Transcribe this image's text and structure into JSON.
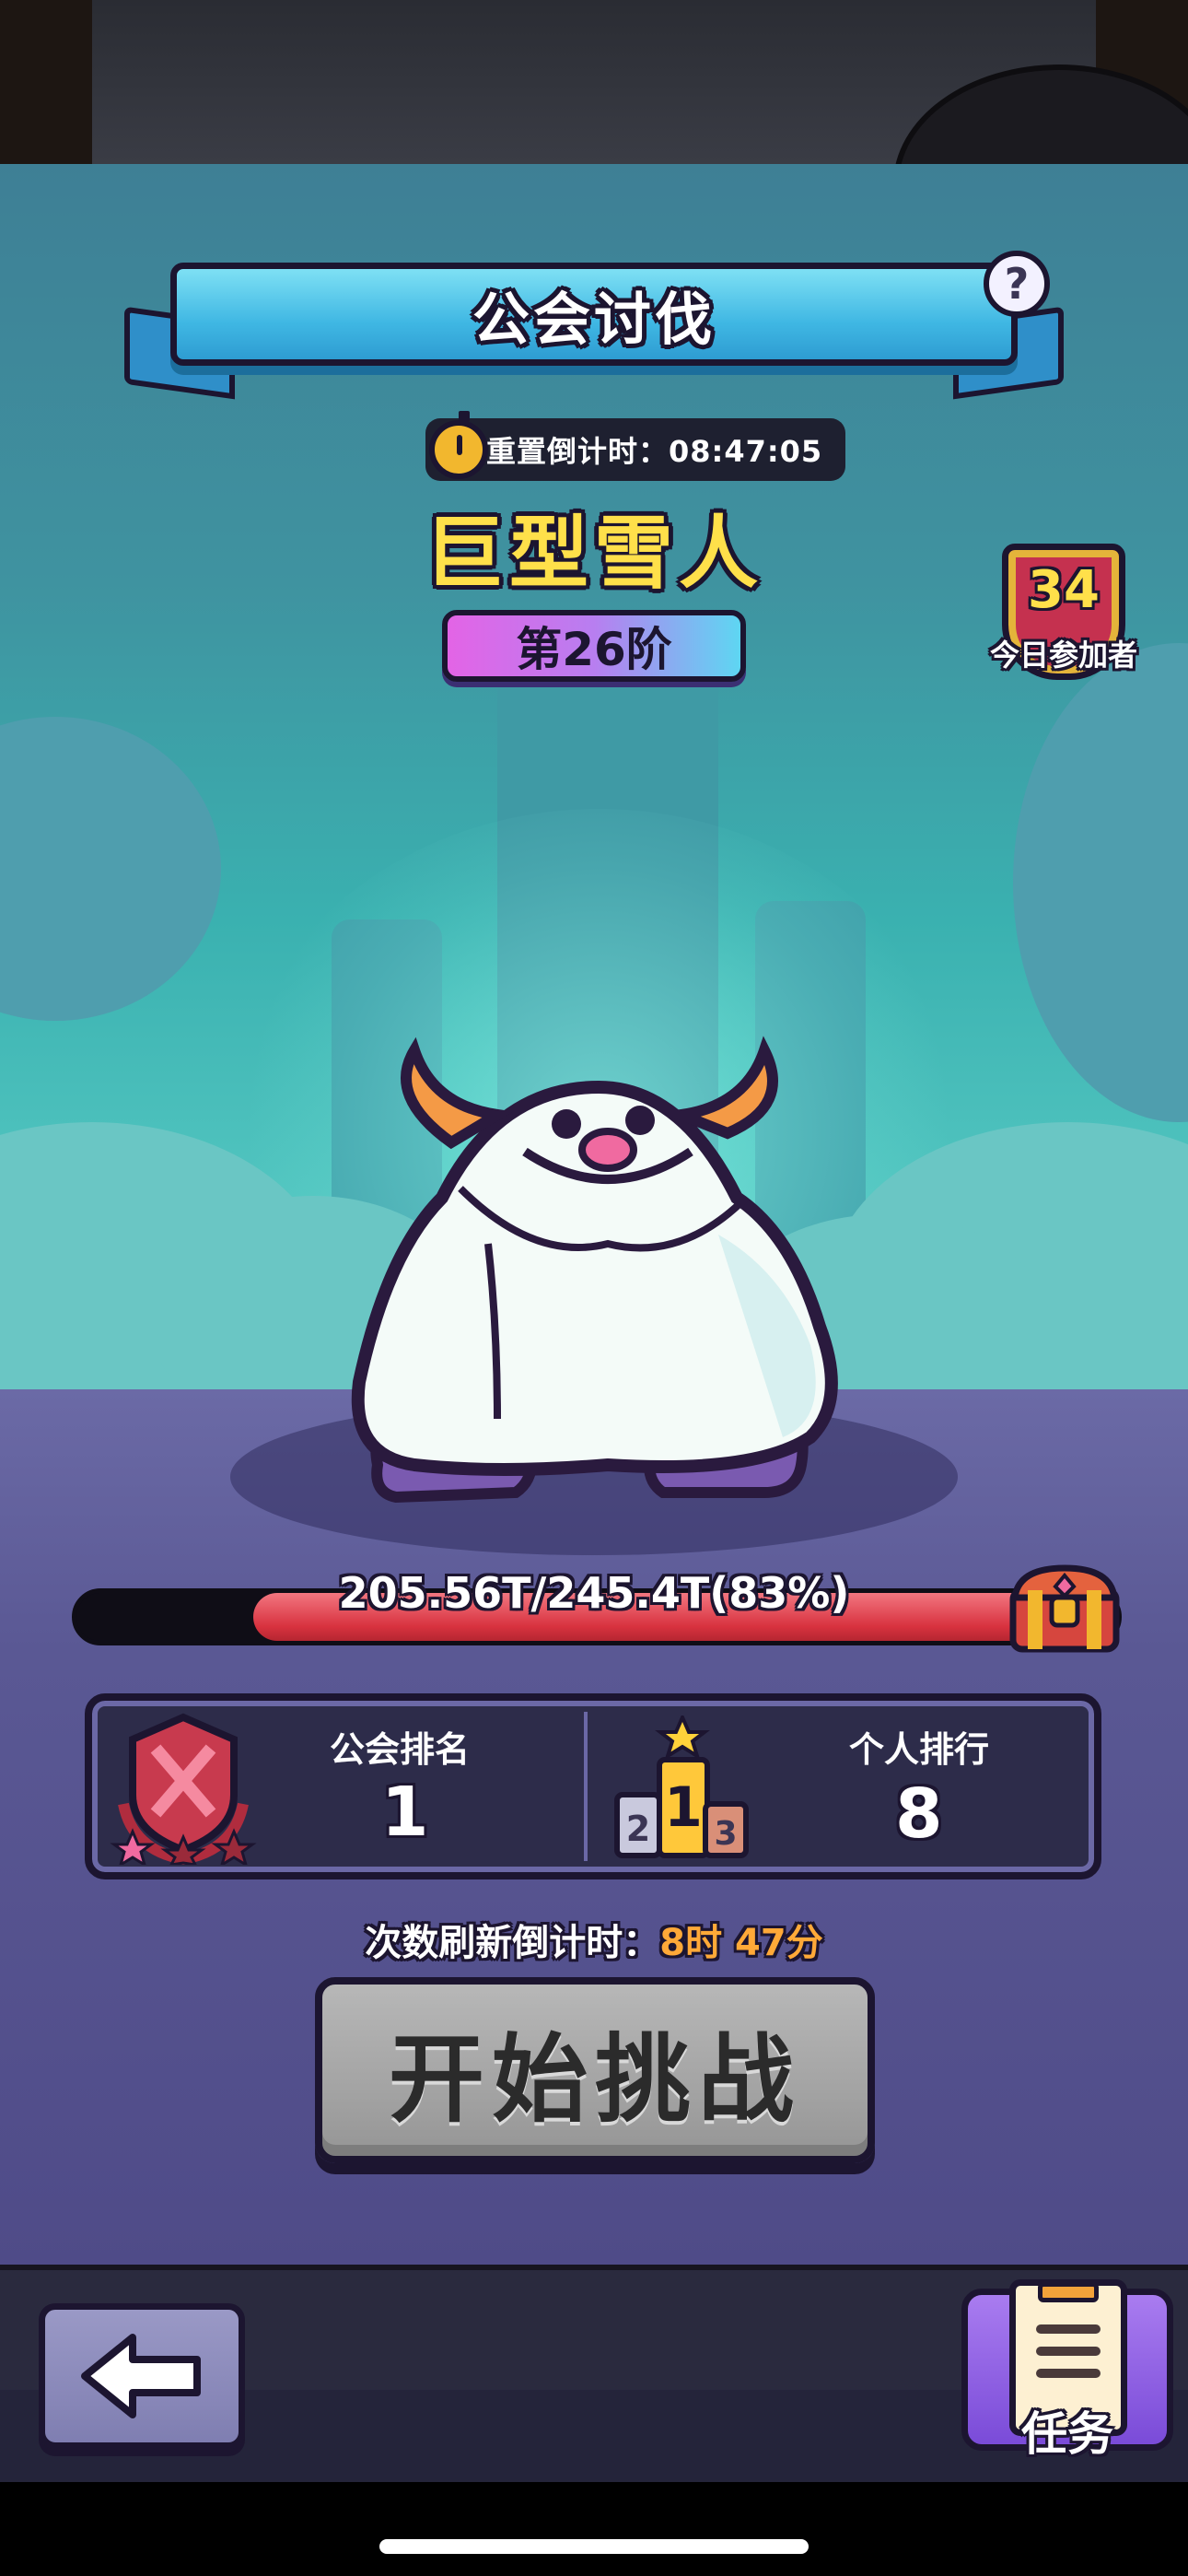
{
  "screen": {
    "title": "公会讨伐",
    "help_icon": "?",
    "reset_countdown": "重置倒计时：08:47:05",
    "boss_name": "巨型雪人",
    "tier": "第26阶",
    "participants": {
      "count": "34",
      "label": "今日参加者"
    }
  },
  "boss_hp": {
    "text": "205.56T/245.4T(83%)",
    "current": 205.56,
    "max": 245.4,
    "percent": 83,
    "reward_icon": "treasure-chest"
  },
  "ranking": {
    "guild_label": "公会排名",
    "guild_value": "1",
    "personal_label": "个人排行",
    "personal_value": "8",
    "podium_digits": [
      "2",
      "1",
      "3"
    ]
  },
  "refresh": {
    "label": "次数刷新倒计时：",
    "value": "8时 47分"
  },
  "challenge_button": "开始挑战",
  "bottom_nav": {
    "back_icon": "arrow-left",
    "task_label": "任务"
  },
  "colors": {
    "accent_yellow": "#ffe04a",
    "hp_red": "#d8323f",
    "timer_orange": "#ffa938",
    "banner_blue": "#3fb7e3"
  }
}
